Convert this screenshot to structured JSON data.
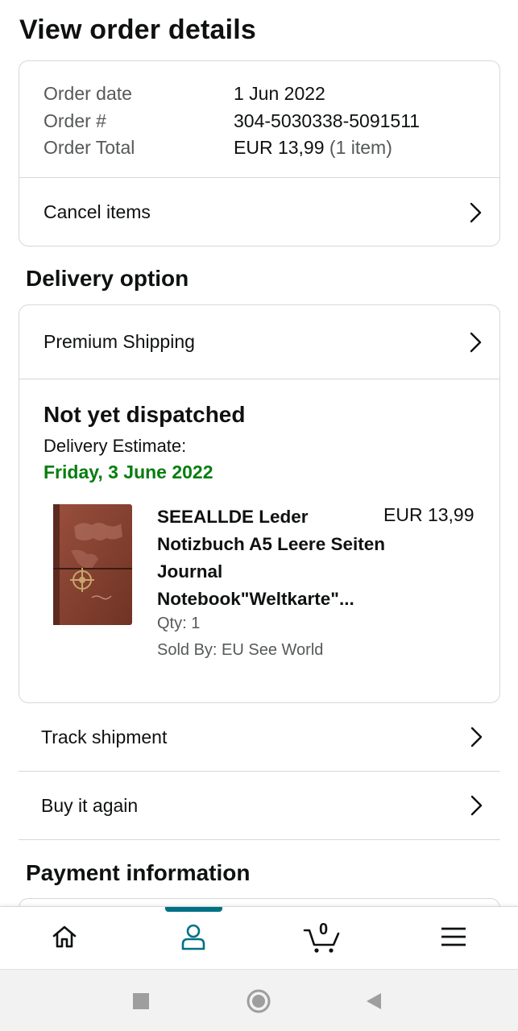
{
  "page": {
    "title": "View order details"
  },
  "order": {
    "date_label": "Order date",
    "date_value": "1 Jun 2022",
    "number_label": "Order #",
    "number_value": "304-5030338-5091511",
    "total_label": "Order Total",
    "total_value": "EUR 13,99",
    "total_items": "(1 item)",
    "cancel_label": "Cancel items"
  },
  "delivery": {
    "section_title": "Delivery option",
    "shipping_label": "Premium Shipping",
    "status": "Not yet dispatched",
    "estimate_label": "Delivery Estimate:",
    "estimate_date": "Friday, 3 June 2022",
    "product": {
      "title": "SEEALLDE Leder Notizbuch A5 Leere Seiten Journal Notebook\"Weltkarte\"...",
      "price": "EUR 13,99",
      "qty": "Qty: 1",
      "seller": "Sold By: EU See World",
      "image_icon": "brown-leather-notebook-image"
    }
  },
  "actions": {
    "track_label": "Track shipment",
    "buy_again_label": "Buy it again"
  },
  "payment": {
    "section_title": "Payment information"
  },
  "bottom_nav": {
    "items": [
      {
        "icon": "home-icon"
      },
      {
        "icon": "account-icon",
        "active": true
      },
      {
        "icon": "cart-icon",
        "badge": "0"
      },
      {
        "icon": "menu-icon"
      }
    ],
    "active_color": "#007185"
  },
  "system_nav": {
    "icons": [
      "recent-apps-icon",
      "home-circle-icon",
      "back-icon"
    ]
  },
  "colors": {
    "estimate_green": "#067d0f",
    "border": "#d5d9d9",
    "muted_text": "#565959"
  }
}
